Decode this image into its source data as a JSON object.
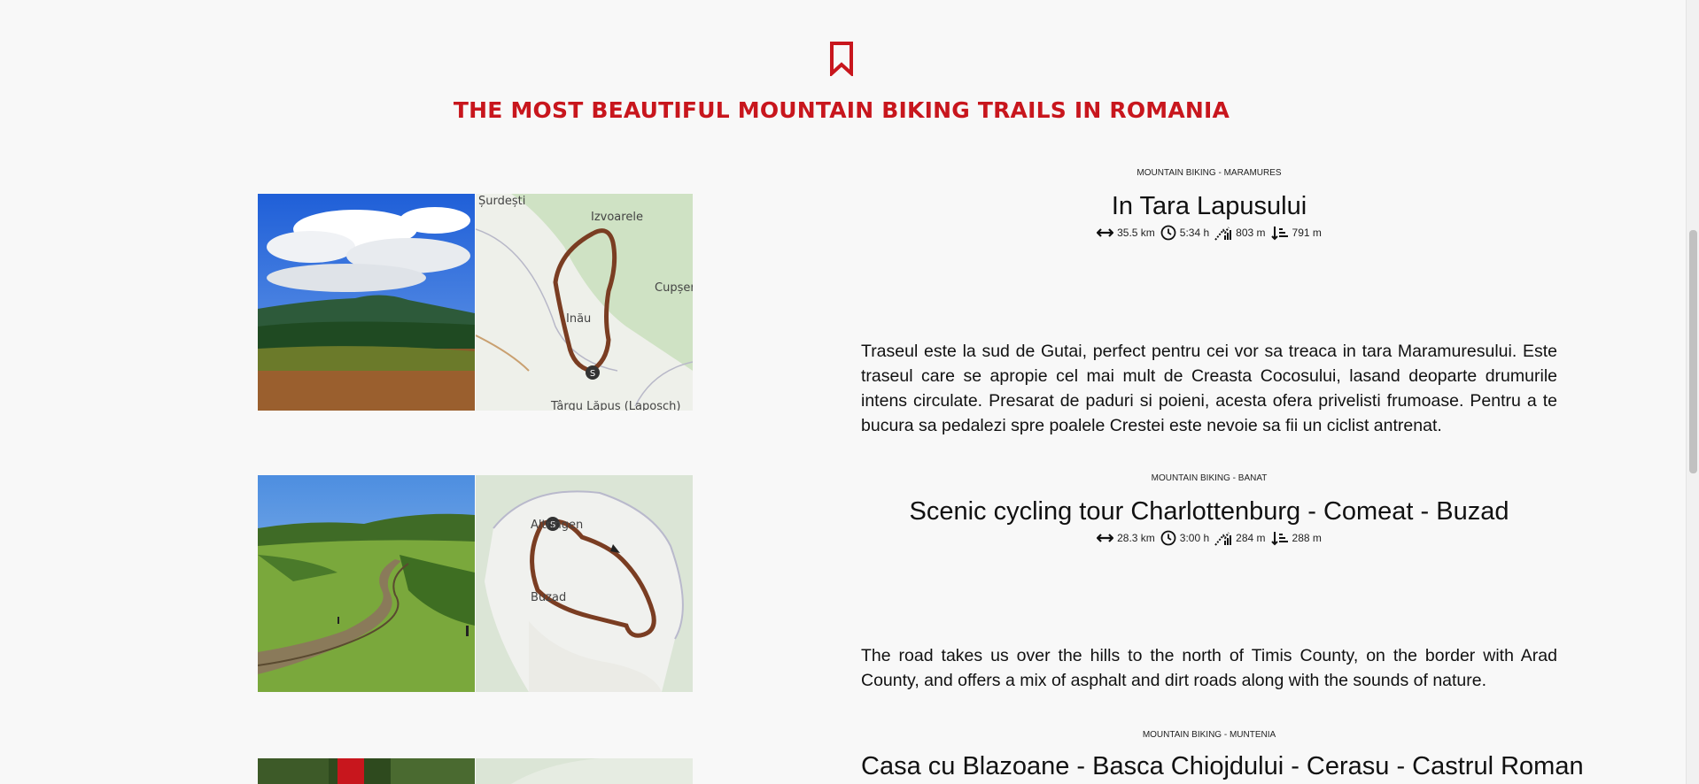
{
  "page": {
    "title": "THE MOST BEAUTIFUL MOUNTAIN BIKING TRAILS IN ROMANIA",
    "accent_color": "#c8161d",
    "header_icon": "bookmark-icon"
  },
  "trails": [
    {
      "category": "MOUNTAIN BIKING - MARAMURES",
      "name": "In Tara Lapusului",
      "distance": "35.5 km",
      "duration": "5:34 h",
      "ascent": "803 m",
      "descent": "791 m",
      "description": "Traseul este la sud de Gutai, perfect pentru cei vor sa treaca in tara Maramuresului. Este traseul care se apropie cel mai mult de Creasta Cocosului, lasand deoparte drumurile intens circulate. Presarat de paduri si poieni, acesta ofera privelisti frumoase. Pentru a te bucura sa pedalezi spre poalele Crestei este nevoie sa fii un ciclist antrenat.",
      "map_labels": [
        "Șurdești",
        "Izvoarele",
        "Cupșer",
        "Inău",
        "Târgu Lăpuș (Laposch)",
        "S"
      ]
    },
    {
      "category": "MOUNTAIN BIKING - BANAT",
      "name": "Scenic cycling tour Charlottenburg - Comeat - Buzad",
      "distance": "28.3 km",
      "duration": "3:00 h",
      "ascent": "284 m",
      "descent": "288 m",
      "description": "The road takes us over the hills to the north of Timis County, on the border with Arad County, and offers a mix of asphalt and dirt roads along with the sounds of nature.",
      "map_labels": [
        "Altringen",
        "Buzad",
        "S"
      ]
    },
    {
      "category": "MOUNTAIN BIKING - MUNTENIA",
      "name": "Casa cu Blazoane - Basca Chiojdului - Cerasu - Castrul Roman"
    }
  ]
}
